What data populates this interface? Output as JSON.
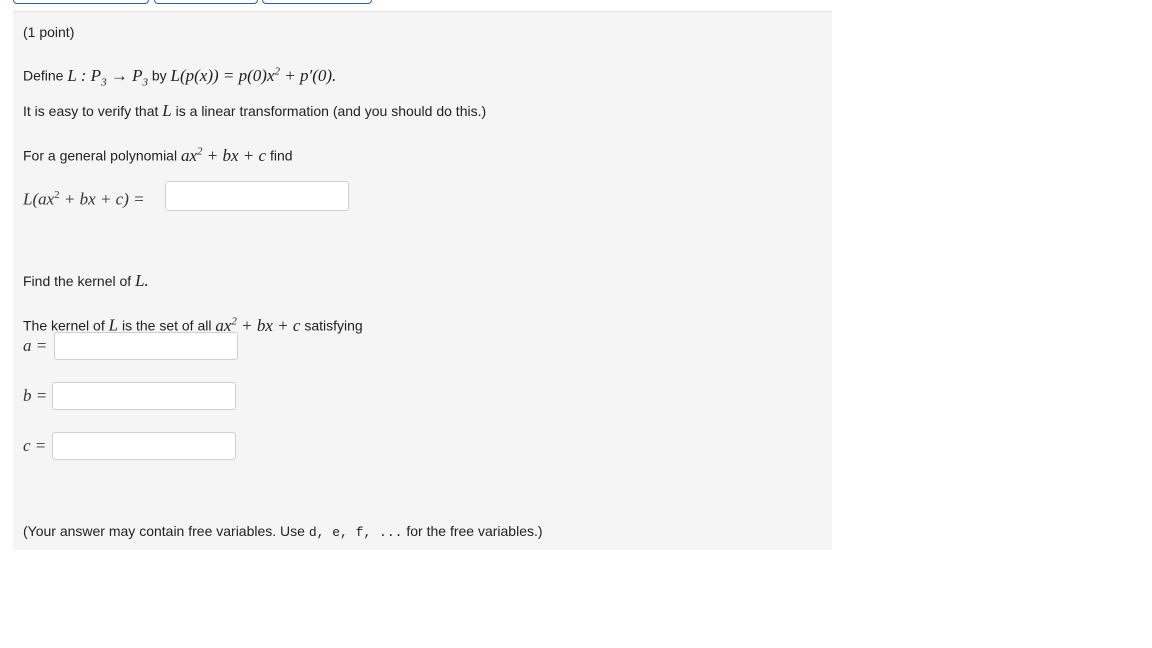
{
  "problem": {
    "points": "(1 point)",
    "define_prefix": "Define",
    "define_by": "by",
    "verify_a": "It is easy to verify that",
    "verify_b": "is a linear transformation (and you should do this.)",
    "general_a": "For a general polynomial",
    "general_b": "find",
    "kernel_a": "Find the kernel of",
    "kernel_set_a": "The kernel of",
    "kernel_set_b": "is the set of all",
    "kernel_set_c": "satisfying",
    "note_a": "(Your answer may contain free variables. Use",
    "note_vars": "d, e, f, ...",
    "note_b": "for the free variables.)"
  },
  "math": {
    "map": "L : P",
    "sub3": "3",
    "arrow": " → P",
    "rule_lhs": "L(p(x)) = p(0)x",
    "sq": "2",
    "rule_rhs": " + p′(0).",
    "L": "L",
    "L_dot": "L.",
    "poly_a": "ax",
    "poly_b": " + bx + c",
    "eval_a": "L(ax",
    "eval_b": " + bx + c) ="
  },
  "inputs": {
    "image_value": "",
    "a_label": "a =",
    "a_value": "",
    "b_label": "b =",
    "b_value": "",
    "c_label": "c =",
    "c_value": ""
  }
}
